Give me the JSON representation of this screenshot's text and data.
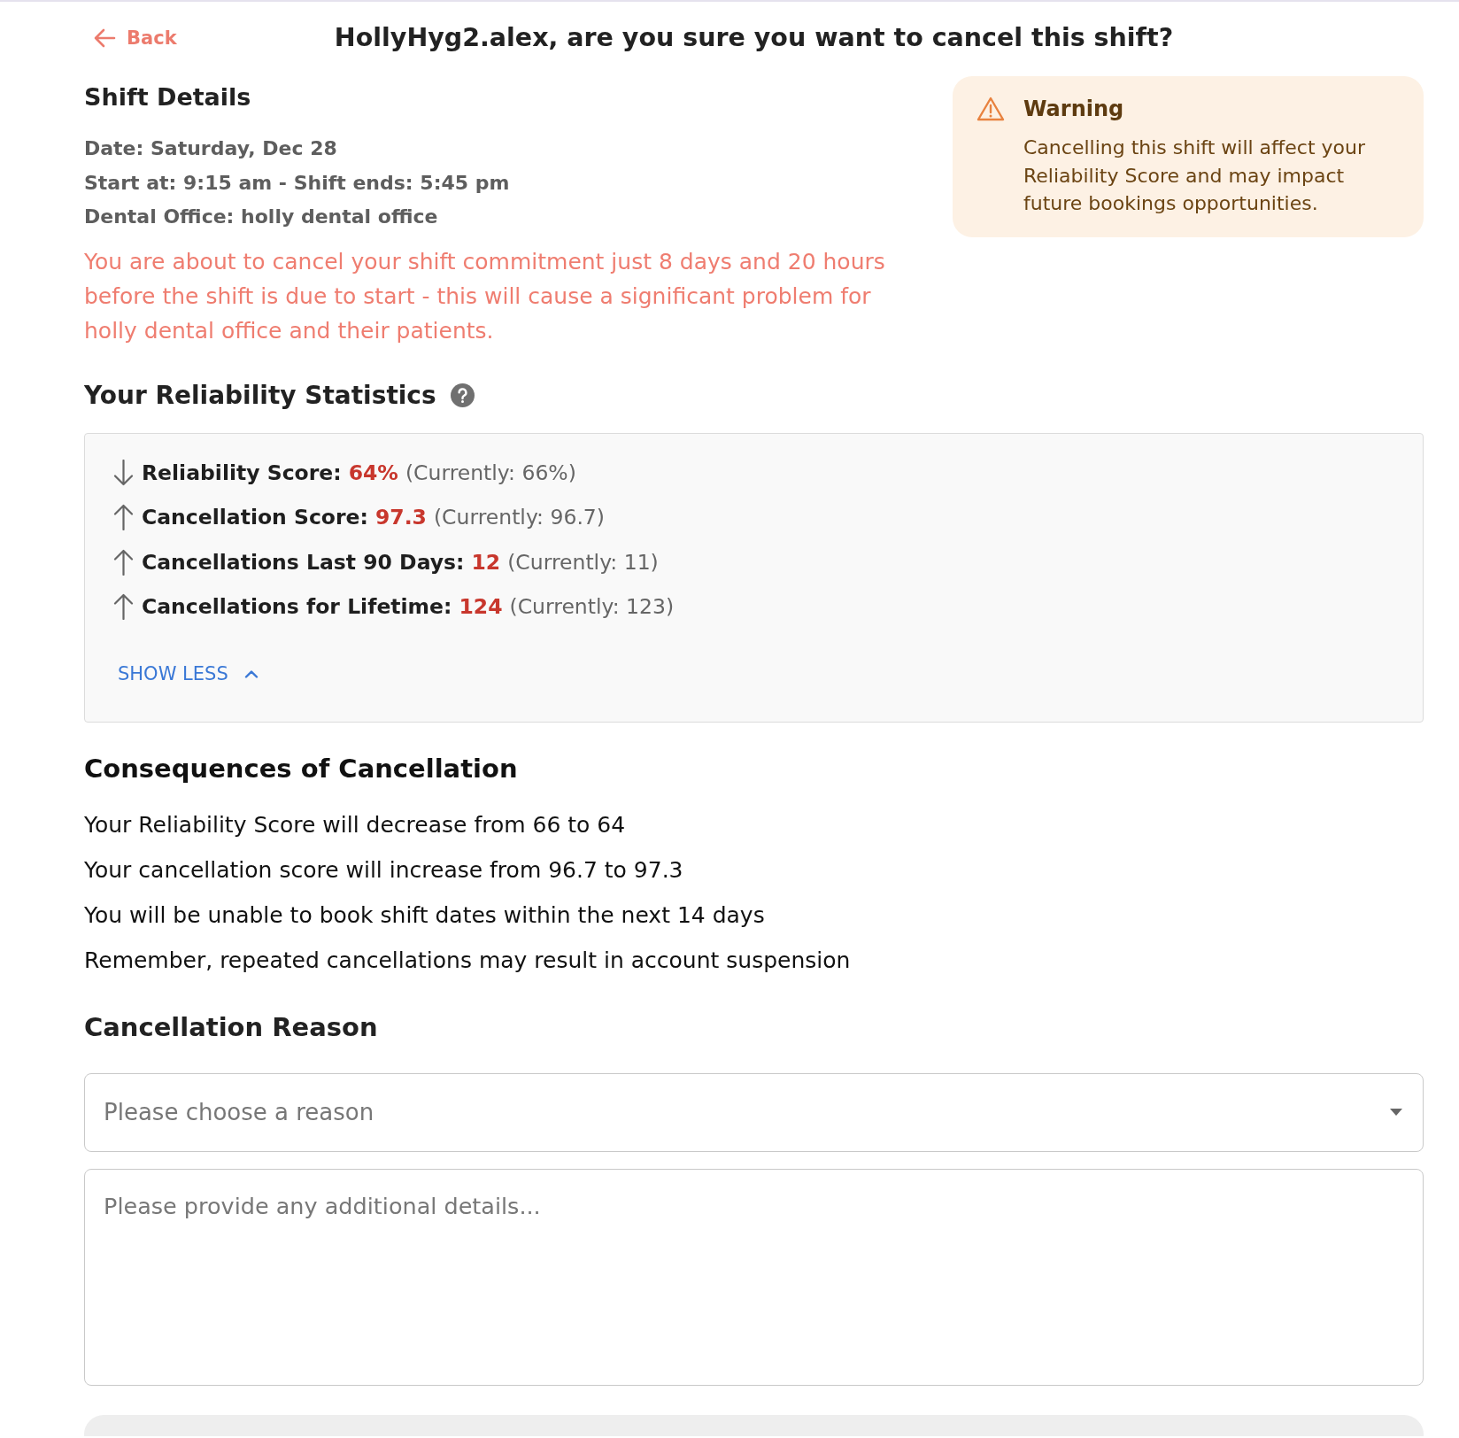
{
  "back_link": {
    "label": "Back"
  },
  "title": "HollyHyg2.alex, are you sure you want to cancel this shift?",
  "shift_details": {
    "heading": "Shift Details",
    "lines": [
      "Date: Saturday, Dec 28",
      "Start at: 9:15 am - Shift ends: 5:45 pm",
      "Dental Office: holly dental office"
    ],
    "notice": "You are about to cancel your shift commitment just 8 days and 20 hours before the shift is due to start - this will cause a significant problem for holly dental office and their patients."
  },
  "warning": {
    "title": "Warning",
    "message": "Cancelling this shift will affect your Reliability Score and may impact future bookings opportunities."
  },
  "reliability": {
    "heading": "Your Reliability Statistics",
    "expanded": true,
    "stats": [
      {
        "kind": "decrease",
        "label": "Reliability Score:",
        "value": "64%",
        "current": "(Currently: 66%)"
      },
      {
        "kind": "increase",
        "label": "Cancellation Score:",
        "value": "97.3",
        "current": "(Currently: 96.7)"
      },
      {
        "kind": "increase",
        "label": "Cancellations Last 90 Days:",
        "value": "12",
        "current": "(Currently: 11)"
      },
      {
        "kind": "increase",
        "label": "Cancellations for Lifetime:",
        "value": "124",
        "current": "(Currently: 123)"
      }
    ],
    "toggle": {
      "label": "SHOW LESS"
    }
  },
  "consequences": {
    "heading": "Consequences of Cancellation",
    "items": [
      "Your Reliability Score will decrease from 66 to 64",
      "Your cancellation score will increase from 96.7 to 97.3",
      "You will be unable to book shift dates within the next 14 days",
      "Remember, repeated cancellations may result in account suspension"
    ]
  },
  "cancellation_reason": {
    "heading": "Cancellation Reason",
    "reason_select": {
      "placeholder": "Please choose a reason"
    },
    "details_field": {
      "placeholder": "Please provide any additional details..."
    }
  }
}
